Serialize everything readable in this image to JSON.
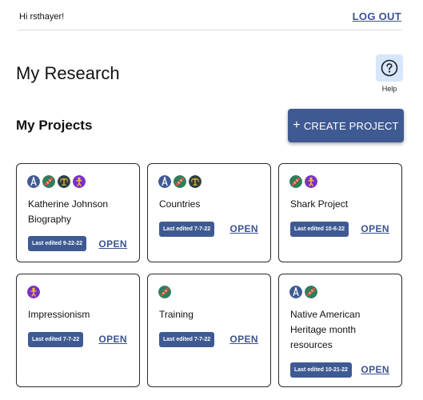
{
  "header": {
    "greeting": "Hi rsthayer!",
    "logout_label": "LOG OUT"
  },
  "main": {
    "title": "My Research",
    "help_label": "Help",
    "section_title": "My Projects",
    "create_plus": "+",
    "create_label": "CREATE PROJECT",
    "open_label": "OPEN"
  },
  "icon_legend": {
    "compass": {
      "name": "compass-icon",
      "color": "#3f5a93"
    },
    "dna": {
      "name": "dna-icon",
      "color": "#2e7d5b"
    },
    "scale": {
      "name": "scale-icon",
      "color": "#2b3f42"
    },
    "person": {
      "name": "person-icon",
      "color": "#7b2fc7"
    }
  },
  "projects": [
    {
      "title": "Katherine Johnson Biography",
      "edited": "Last edited 9-22-22",
      "icons": [
        "compass",
        "dna",
        "scale",
        "person"
      ]
    },
    {
      "title": "Countries",
      "edited": "Last edited 7-7-22",
      "icons": [
        "compass",
        "dna",
        "scale"
      ]
    },
    {
      "title": "Shark Project",
      "edited": "Last edited 10-6-22",
      "icons": [
        "dna",
        "person"
      ]
    },
    {
      "title": "Impressionism",
      "edited": "Last edited 7-7-22",
      "icons": [
        "person"
      ]
    },
    {
      "title": "Training",
      "edited": "Last edited 7-7-22",
      "icons": [
        "dna"
      ]
    },
    {
      "title": "Native American Heritage month resources",
      "edited": "Last edited 10-21-22",
      "icons": [
        "compass",
        "dna"
      ]
    }
  ]
}
